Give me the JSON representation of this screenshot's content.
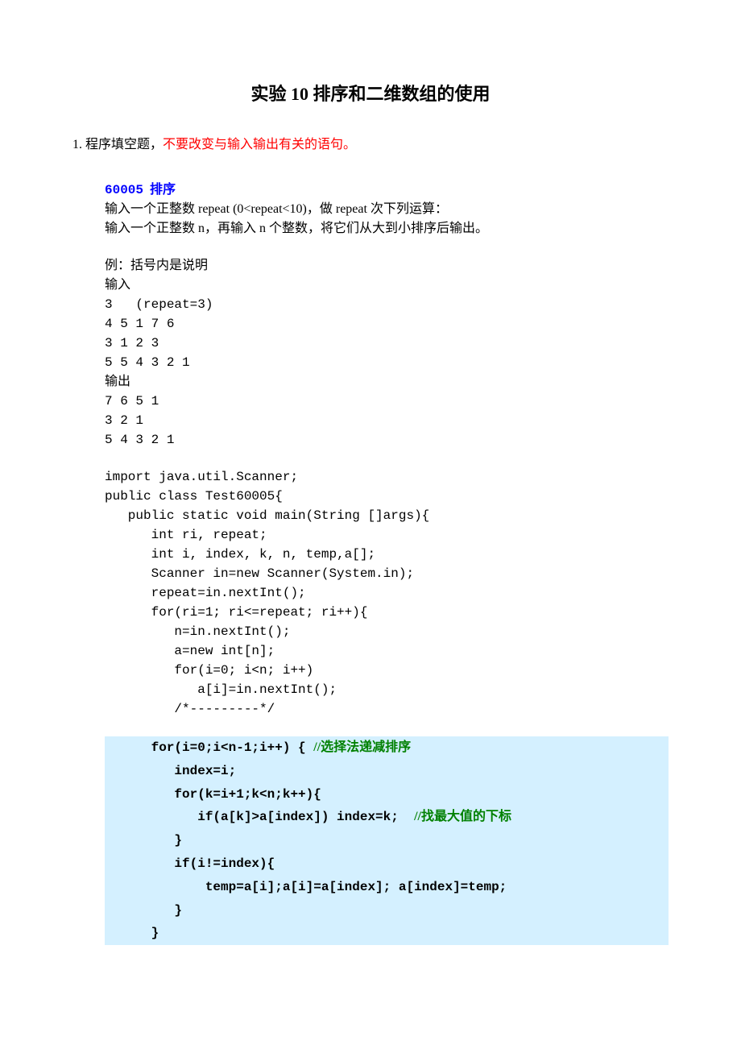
{
  "title": "实验 10   排序和二维数组的使用",
  "q1": {
    "num": "1.",
    "label": "程序填空题，",
    "red_note": "不要改变与输入输出有关的语句。"
  },
  "sec": {
    "id": "60005",
    "name": "排序",
    "desc1a": "输入一个正整数 repeat (0<repeat<10)，做 repeat 次下列运算：",
    "desc2a": "输入一个正整数 n，再输入 n 个整数，将它们从大到小排序后输出。",
    "note": "例：括号内是说明",
    "in_lbl": "输入",
    "in1": "3   (repeat=3)",
    "in2": "4 5 1 7 6",
    "in3": "3 1 2 3",
    "in4": "5 5 4 3 2 1",
    "out_lbl": "输出",
    "out1": "7 6 5 1",
    "out2": "3 2 1",
    "out3": "5 4 3 2 1"
  },
  "code": {
    "l1": "import java.util.Scanner;",
    "l2": "public class Test60005{",
    "l3": "   public static void main(String []args){",
    "l4": "      int ri, repeat;",
    "l5": "      int i, index, k, n, temp,a[];",
    "l6": "      Scanner in=new Scanner(System.in);",
    "l7": "      repeat=in.nextInt();",
    "l8": "      for(ri=1; ri<=repeat; ri++){",
    "l9": "         n=in.nextInt();",
    "l10": "         a=new int[n];",
    "l11": "         for(i=0; i<n; i++)",
    "l12": "            a[i]=in.nextInt();",
    "l13": "         /*---------*/"
  },
  "ans": {
    "a1a": "      for(i=0;i<n-1;i++) { ",
    "a1c": "//选择法递减排序",
    "a2": "         index=i;",
    "a3": "         for(k=i+1;k<n;k++){",
    "a4a": "            if(a[k]>a[index]) index=k;  ",
    "a4c": "//找最大值的下标",
    "a5": "         }",
    "a6": "         if(i!=index){",
    "a7": "             temp=a[i];a[i]=a[index]; a[index]=temp;",
    "a8": "         }",
    "a9": "      }"
  }
}
